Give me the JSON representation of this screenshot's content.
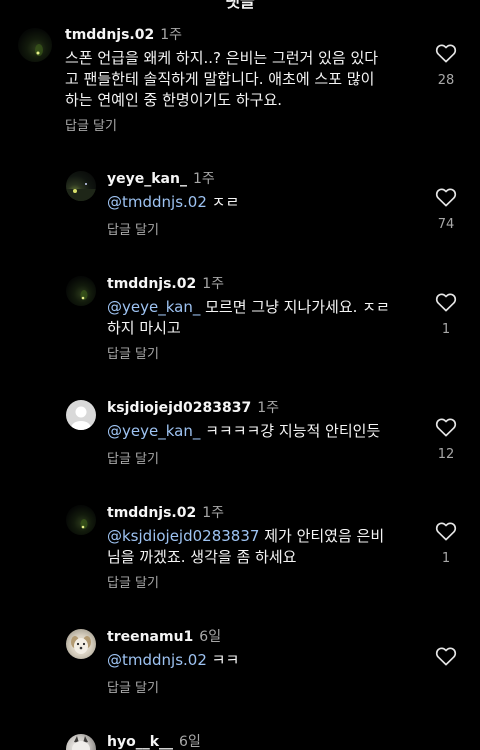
{
  "header": {
    "title": "댓글"
  },
  "comments": [
    {
      "username": "tmddnjs.02",
      "time": "1주",
      "lines": [
        "스폰 언급을 왜케 하지..? 은비는 그런거 있음 있다",
        "고 팬들한테 솔직하게 말합니다. 애초에 스포 많이",
        "하는 연예인 중 한명이기도 하구요."
      ],
      "reply_label": "답글 달기",
      "likes": "28",
      "avatar": "dark-avatar"
    },
    {
      "username": "yeye_kan_",
      "time": "1주",
      "mention": "@tmddnjs.02",
      "text": " ㅈㄹ",
      "reply_label": "답글 달기",
      "likes": "74",
      "avatar": "night-sky-avatar"
    },
    {
      "username": "tmddnjs.02",
      "time": "1주",
      "mention": "@yeye_kan_",
      "text": " 모르면 그냥 지나가세요. ㅈㄹ",
      "line2": "하지 마시고",
      "reply_label": "답글 달기",
      "likes": "1",
      "avatar": "dark-avatar"
    },
    {
      "username": "ksjdiojejd0283837",
      "time": "1주",
      "mention": "@yeye_kan_",
      "text": " ㅋㅋㅋㅋ걍 지능적 안티인듯",
      "reply_label": "답글 달기",
      "likes": "12",
      "avatar": "default-avatar"
    },
    {
      "username": "tmddnjs.02",
      "time": "1주",
      "mention": "@ksjdiojejd0283837",
      "text": " 제가 안티였음 은비",
      "line2": "님을 까겠죠. 생각을 좀 하세요",
      "reply_label": "답글 달기",
      "likes": "1",
      "avatar": "dark-avatar"
    },
    {
      "username": "treenamu1",
      "time": "6일",
      "mention": "@tmddnjs.02",
      "text": " ㅋㅋ",
      "reply_label": "답글 달기",
      "likes": "",
      "avatar": "dog-avatar"
    },
    {
      "username": "hyo__k__",
      "time": "6일",
      "avatar": "cat-avatar"
    }
  ],
  "icons": {
    "like": "heart-outline-icon"
  },
  "colors": {
    "background": "#000000",
    "text": "#f5f5f5",
    "muted": "#a8a8a8",
    "mention": "#9ec3f2"
  }
}
